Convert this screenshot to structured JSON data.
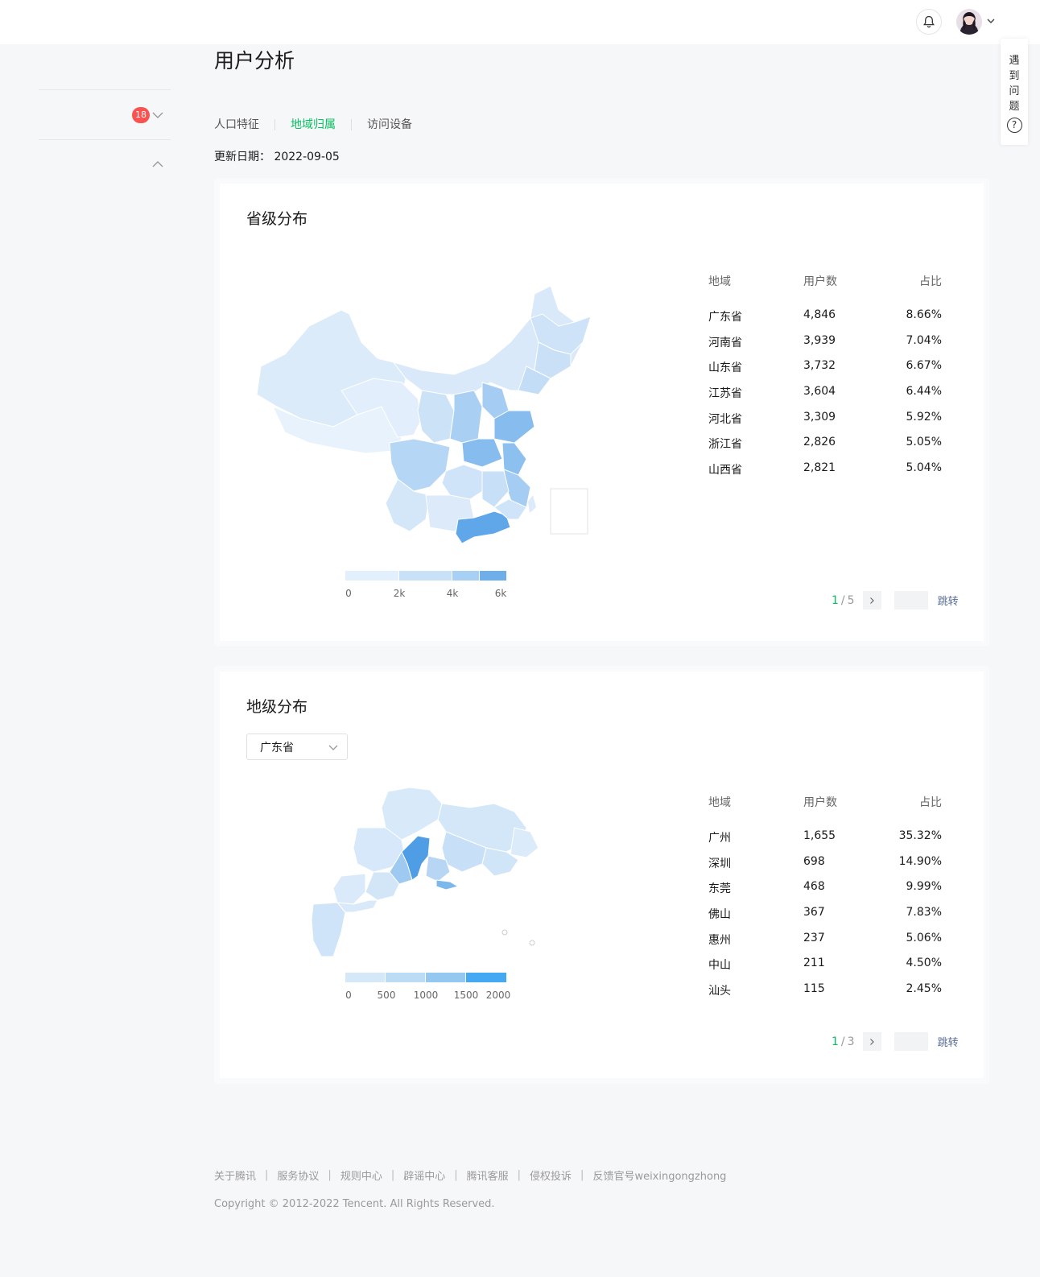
{
  "header": {
    "bell_icon": "bell-icon",
    "avatar_icon": "user-avatar",
    "caret_icon": "chevron-down-icon"
  },
  "helpdesk": {
    "text": "遇到问题",
    "icon_text": "?"
  },
  "sidebar": {
    "badge": "18"
  },
  "page": {
    "title": "用户分析"
  },
  "tabs": [
    {
      "label": "人口特征",
      "active": false
    },
    {
      "label": "地域归属",
      "active": true
    },
    {
      "label": "访问设备",
      "active": false
    }
  ],
  "update": {
    "label": "更新日期：",
    "date": "2022-09-05"
  },
  "province_section": {
    "title": "省级分布",
    "legend": {
      "ticks": [
        "0",
        "2k",
        "4k",
        "6k"
      ],
      "colors": [
        "#e2effc",
        "#c9e1f8",
        "#a8cff4",
        "#6eafe9"
      ]
    },
    "table": {
      "headers": [
        "地域",
        "用户数",
        "占比"
      ],
      "rows": [
        [
          "广东省",
          "4,846",
          "8.66%"
        ],
        [
          "河南省",
          "3,939",
          "7.04%"
        ],
        [
          "山东省",
          "3,732",
          "6.67%"
        ],
        [
          "江苏省",
          "3,604",
          "6.44%"
        ],
        [
          "河北省",
          "3,309",
          "5.92%"
        ],
        [
          "浙江省",
          "2,826",
          "5.05%"
        ],
        [
          "山西省",
          "2,821",
          "5.04%"
        ]
      ]
    },
    "pager": {
      "current": "1",
      "sep": "/",
      "total": "5",
      "jump": "跳转"
    }
  },
  "city_section": {
    "title": "地级分布",
    "select_value": "广东省",
    "legend": {
      "ticks": [
        "0",
        "500",
        "1000",
        "1500",
        "2000"
      ],
      "colors": [
        "#d5e8f8",
        "#bcdcf6",
        "#95c8f1",
        "#44a9f2"
      ]
    },
    "table": {
      "headers": [
        "地域",
        "用户数",
        "占比"
      ],
      "rows": [
        [
          "广州",
          "1,655",
          "35.32%"
        ],
        [
          "深圳",
          "698",
          "14.90%"
        ],
        [
          "东莞",
          "468",
          "9.99%"
        ],
        [
          "佛山",
          "367",
          "7.83%"
        ],
        [
          "惠州",
          "237",
          "5.06%"
        ],
        [
          "中山",
          "211",
          "4.50%"
        ],
        [
          "汕头",
          "115",
          "2.45%"
        ]
      ]
    },
    "pager": {
      "current": "1",
      "sep": "/",
      "total": "3",
      "jump": "跳转"
    }
  },
  "footer": {
    "links": [
      "关于腾讯",
      "服务协议",
      "规则中心",
      "辟谣中心",
      "腾讯客服",
      "侵权投诉",
      "反馈官号weixingongzhong"
    ],
    "separator": "|",
    "copyright": "Copyright © 2012-2022 Tencent. All Rights Reserved."
  }
}
